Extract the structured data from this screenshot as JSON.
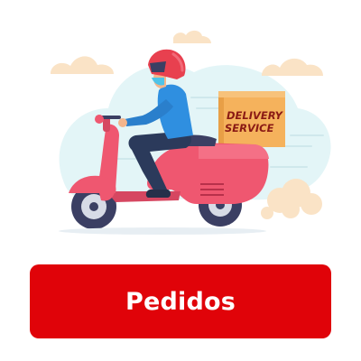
{
  "illustration": {
    "box_label_line1": "DELIVERY",
    "box_label_line2": "SERVICE",
    "icon": "delivery-scooter-illustration"
  },
  "button": {
    "label": "Pedidos"
  },
  "colors": {
    "accent": "#e00309",
    "scooter": "#ef5770",
    "helmet": "#e8404f",
    "shirt": "#2f8fe0",
    "box": "#f5b25c",
    "background_blob": "#e3f5f7",
    "cloud": "#fae3c6"
  }
}
